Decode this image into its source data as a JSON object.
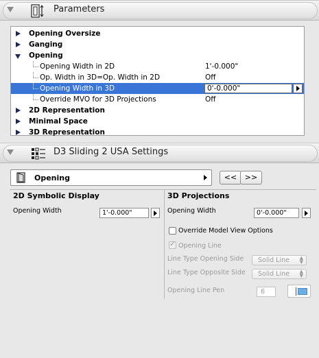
{
  "headers": {
    "parameters_title": "Parameters",
    "settings_title": "D3 Sliding 2 USA Settings"
  },
  "tree": {
    "groups": [
      {
        "label": "Opening Oversize"
      },
      {
        "label": "Ganging"
      },
      {
        "label": "Opening"
      }
    ],
    "params": [
      {
        "label": "Opening Width in 2D",
        "value": "1'-0.000\""
      },
      {
        "label": "Op. Width in 3D=Op. Width in 2D",
        "value": "Off"
      },
      {
        "label": "Opening Width in 3D",
        "value": "0'-0.000\""
      },
      {
        "label": "Override MVO for 3D Projections",
        "value": "Off"
      }
    ],
    "groups_after": [
      {
        "label": "2D Representation"
      },
      {
        "label": "Minimal Space"
      },
      {
        "label": "3D Representation"
      }
    ]
  },
  "selector": {
    "label": "Opening",
    "prev_label": "<<",
    "next_label": ">>"
  },
  "left_panel": {
    "title": "2D Symbolic Display",
    "opening_width_label": "Opening Width",
    "opening_width_value": "1'-0.000\""
  },
  "right_panel": {
    "title": "3D Projections",
    "opening_width_label": "Opening Width",
    "opening_width_value": "0'-0.000\"",
    "override_mvo_label": "Override Model View Options",
    "opening_line_label": "Opening Line",
    "line_type_opening_side_label": "Line Type Opening Side",
    "line_type_opening_side_value": "Solid Line",
    "line_type_opposite_side_label": "Line Type Opposite Side",
    "line_type_opposite_side_value": "Solid Line",
    "opening_line_pen_label": "Opening Line Pen",
    "opening_line_pen_value": "6"
  },
  "colors": {
    "selection": "#3875d7",
    "pen_swatch": "#6aaee8"
  },
  "icons": {
    "parameters": "parameters-icon",
    "settings": "settings-grid-icon",
    "door": "door-icon"
  }
}
